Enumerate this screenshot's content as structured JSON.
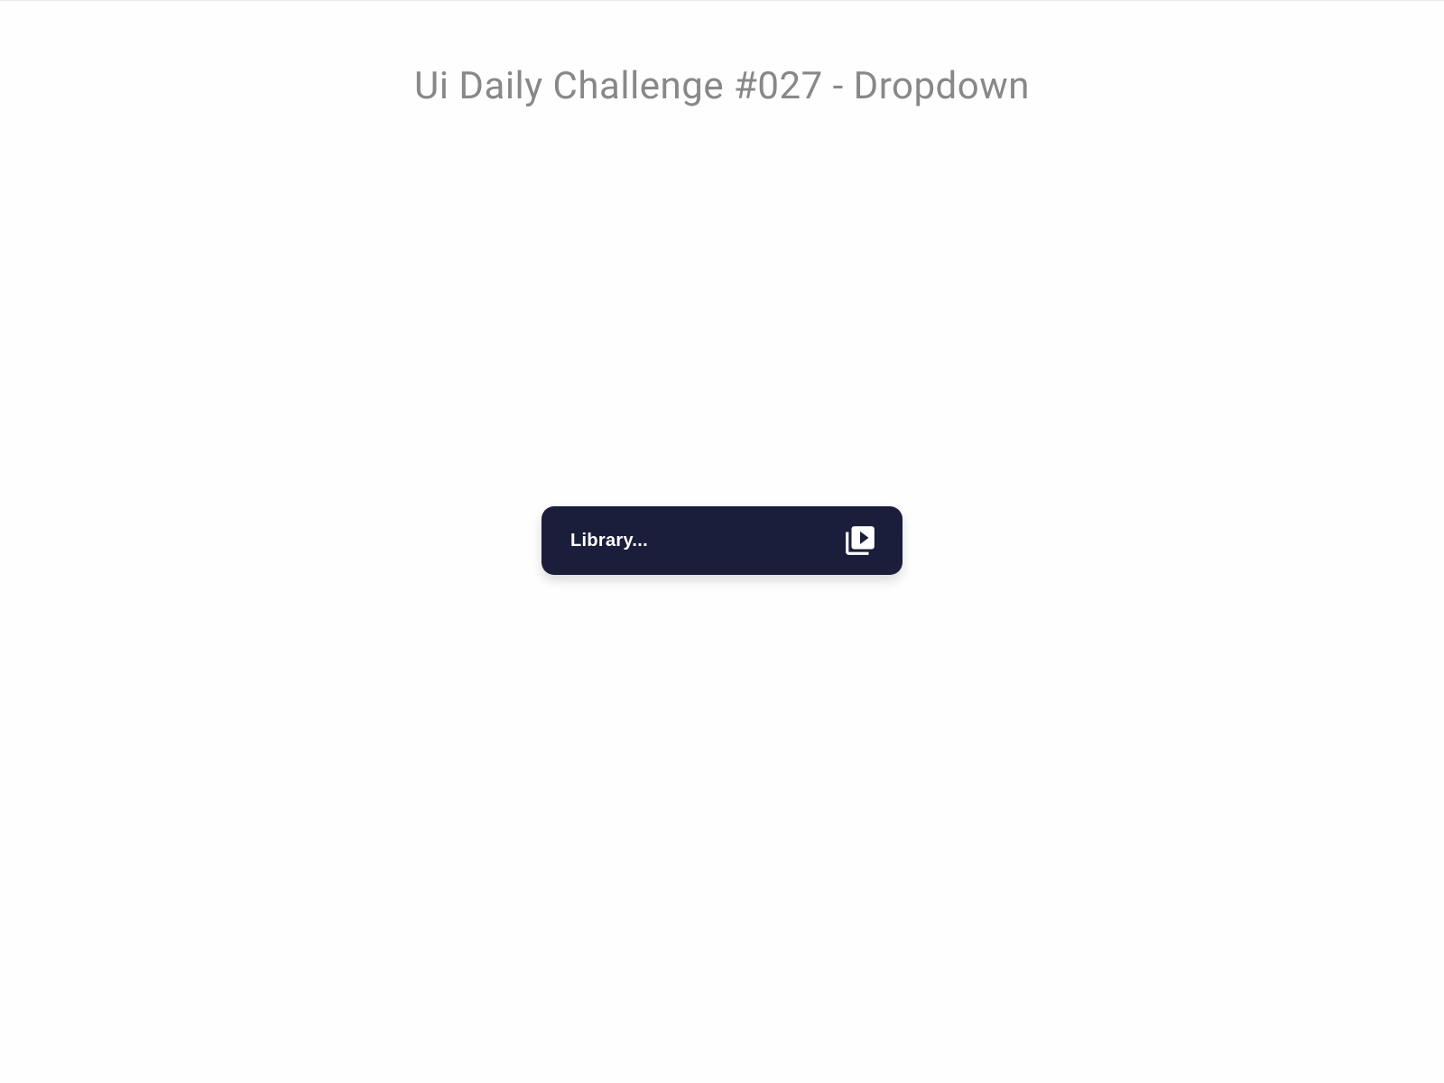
{
  "title": "Ui Daily Challenge #027 - Dropdown",
  "dropdown": {
    "label": "Library...",
    "icon": "video-library-icon"
  },
  "colors": {
    "button_bg": "#1a1e3a",
    "button_text": "#ffffff",
    "title_text": "#888888",
    "page_bg": "#fefefe"
  }
}
